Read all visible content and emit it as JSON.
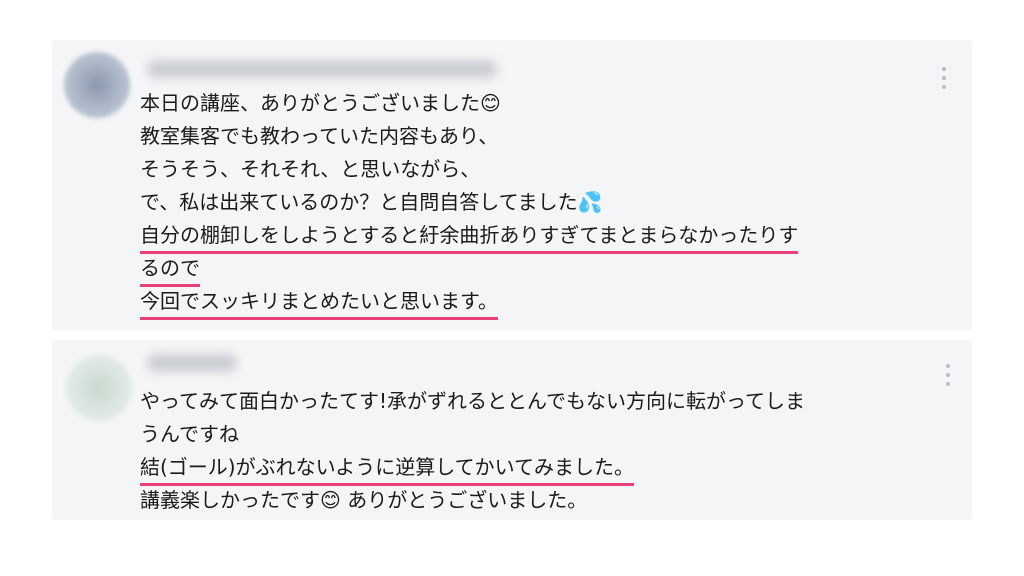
{
  "comments": [
    {
      "author_name": "",
      "lines": [
        "本日の講座、ありがとうございました😊",
        "教室集客でも教わっていた内容もあり、",
        "そうそう、それそれ、と思いながら、",
        "で、私は出来ているのか？と自問自答してました💦",
        "自分の棚卸しをしようとすると紆余曲折ありすぎてまとまらなかったりす",
        "るので",
        "今回でスッキリまとめたいと思います。"
      ],
      "underlined_line_indexes": [
        4,
        5,
        6
      ],
      "menu_icon": "more-vertical-icon"
    },
    {
      "author_name": "",
      "lines": [
        "やってみて面白かったてす!承がずれるととんでもない方向に転がってしま",
        "うんですね",
        "結(ゴール)がぶれないように逆算してかいてみました。",
        "講義楽しかったです😊 ありがとうございました。"
      ],
      "underlined_line_indexes": [
        2
      ],
      "menu_icon": "more-vertical-icon"
    }
  ],
  "colors": {
    "underline": "#e8407a",
    "card_background": "#f4f5f6",
    "text": "#1b1b1b"
  }
}
